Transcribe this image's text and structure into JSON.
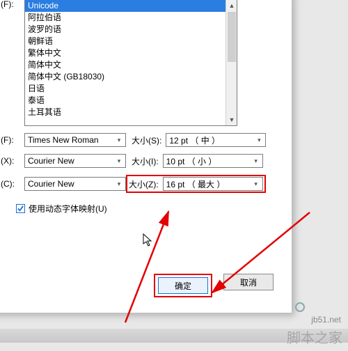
{
  "listbox_label": "(F):",
  "lang_list": [
    "Unicode",
    "阿拉伯语",
    "波罗的语",
    "朝鲜语",
    "繁体中文",
    "简体中文",
    "简体中文 (GB18030)",
    "日语",
    "泰语",
    "土耳其语"
  ],
  "rows": [
    {
      "label": "(F):",
      "font": "Times New Roman",
      "size_label": "大小(S):",
      "size_value": "12 pt （ 中 ）"
    },
    {
      "label": "(X):",
      "font": "Courier New",
      "size_label": "大小(I):",
      "size_value": "10 pt （ 小 ）"
    },
    {
      "label": "(C):",
      "font": "Courier New",
      "size_label": "大小(Z):",
      "size_value": "16 pt （ 最大 ）"
    }
  ],
  "checkbox_label": "使用动态字体映射(U)",
  "buttons": {
    "ok": "确定",
    "cancel": "取消"
  },
  "watermark": {
    "url": "jb51.net",
    "text": "脚本之家"
  }
}
